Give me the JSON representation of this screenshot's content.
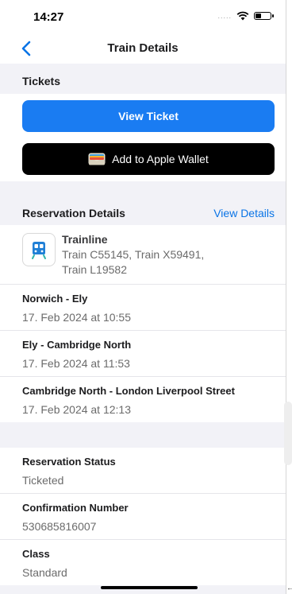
{
  "status": {
    "time": "14:27",
    "signal": "....."
  },
  "nav": {
    "title": "Train Details"
  },
  "tickets": {
    "header": "Tickets",
    "view_ticket": "View Ticket",
    "apple_wallet": "Add to Apple Wallet"
  },
  "reservation": {
    "header": "Reservation Details",
    "view_details": "View Details",
    "provider": {
      "name": "Trainline",
      "trains_line1": "Train C55145, Train X59491,",
      "trains_line2": "Train L19582"
    },
    "legs": [
      {
        "route": "Norwich - Ely",
        "datetime": "17. Feb 2024 at 10:55"
      },
      {
        "route": "Ely - Cambridge North",
        "datetime": "17. Feb 2024 at 11:53"
      },
      {
        "route": "Cambridge North - London Liverpool Street",
        "datetime": "17. Feb 2024 at 12:13"
      }
    ]
  },
  "info": [
    {
      "label": "Reservation Status",
      "value": "Ticketed"
    },
    {
      "label": "Confirmation Number",
      "value": "530685816007"
    },
    {
      "label": "Class",
      "value": "Standard"
    }
  ],
  "colors": {
    "accent": "#1a7cf2",
    "link": "#0a74e6",
    "wallet_bg": "#000000"
  },
  "icons": [
    "chevron-left-icon",
    "wifi-icon",
    "battery-icon",
    "wallet-icon",
    "train-icon"
  ]
}
